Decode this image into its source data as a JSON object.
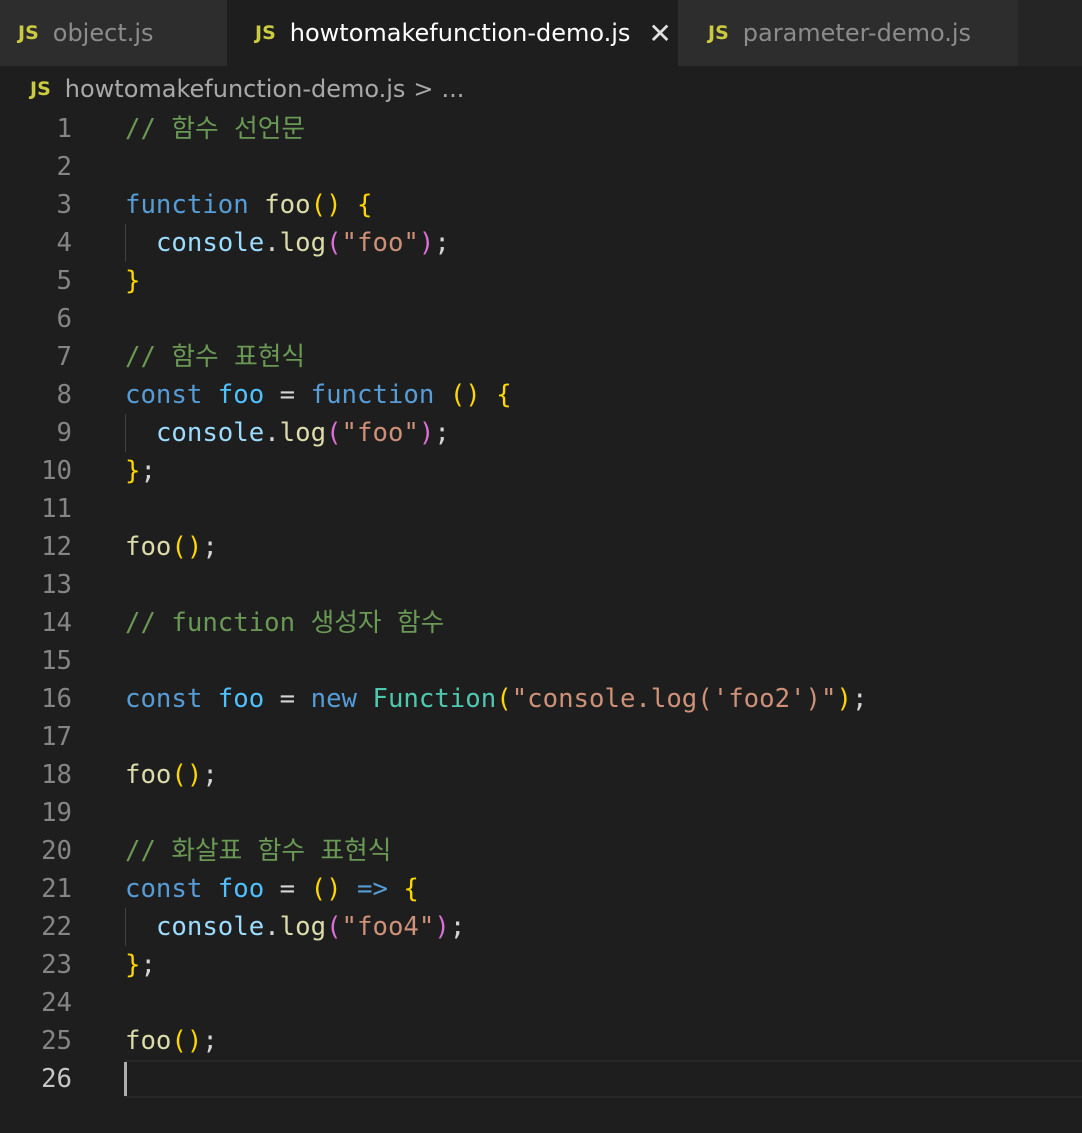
{
  "tabs": [
    {
      "icon": "JS",
      "label": "object.js",
      "active": false
    },
    {
      "icon": "JS",
      "label": "howtomakefunction-demo.js",
      "active": true
    },
    {
      "icon": "JS",
      "label": "parameter-demo.js",
      "active": false
    }
  ],
  "breadcrumb": {
    "icon": "JS",
    "file": "howtomakefunction-demo.js",
    "separator": ">",
    "more": "..."
  },
  "colors": {
    "keyword": "#569cd6",
    "function": "#dcdcaa",
    "string": "#ce9178",
    "comment": "#6a9955",
    "bracket1": "#ffd700",
    "bracket2": "#da70d6"
  },
  "current_line": 26,
  "lines": [
    [
      [
        "// 함수 선언문",
        "comment"
      ]
    ],
    [],
    [
      [
        "function",
        "kw"
      ],
      [
        " ",
        "p"
      ],
      [
        "foo",
        "fn"
      ],
      [
        "()",
        "b1"
      ],
      [
        " ",
        "p"
      ],
      [
        "{",
        "b1"
      ]
    ],
    [
      [
        "  ",
        "p"
      ],
      [
        "console",
        "var"
      ],
      [
        ".",
        "p"
      ],
      [
        "log",
        "fn"
      ],
      [
        "(",
        "b2"
      ],
      [
        "\"foo\"",
        "str"
      ],
      [
        ")",
        "b2"
      ],
      [
        ";",
        "p"
      ]
    ],
    [
      [
        "}",
        "b1"
      ]
    ],
    [],
    [
      [
        "// 함수 표현식",
        "comment"
      ]
    ],
    [
      [
        "const",
        "kw"
      ],
      [
        " ",
        "p"
      ],
      [
        "foo",
        "const"
      ],
      [
        " = ",
        "p"
      ],
      [
        "function",
        "kw"
      ],
      [
        " ",
        "p"
      ],
      [
        "()",
        "b1"
      ],
      [
        " ",
        "p"
      ],
      [
        "{",
        "b1"
      ]
    ],
    [
      [
        "  ",
        "p"
      ],
      [
        "console",
        "var"
      ],
      [
        ".",
        "p"
      ],
      [
        "log",
        "fn"
      ],
      [
        "(",
        "b2"
      ],
      [
        "\"foo\"",
        "str"
      ],
      [
        ")",
        "b2"
      ],
      [
        ";",
        "p"
      ]
    ],
    [
      [
        "}",
        "b1"
      ],
      [
        ";",
        "p"
      ]
    ],
    [],
    [
      [
        "foo",
        "fn"
      ],
      [
        "()",
        "b1"
      ],
      [
        ";",
        "p"
      ]
    ],
    [],
    [
      [
        "// function 생성자 함수",
        "comment"
      ]
    ],
    [],
    [
      [
        "const",
        "kw"
      ],
      [
        " ",
        "p"
      ],
      [
        "foo",
        "const"
      ],
      [
        " = ",
        "p"
      ],
      [
        "new",
        "kw"
      ],
      [
        " ",
        "p"
      ],
      [
        "Function",
        "cls"
      ],
      [
        "(",
        "b1"
      ],
      [
        "\"console.log('foo2')\"",
        "str"
      ],
      [
        ")",
        "b1"
      ],
      [
        ";",
        "p"
      ]
    ],
    [],
    [
      [
        "foo",
        "fn"
      ],
      [
        "()",
        "b1"
      ],
      [
        ";",
        "p"
      ]
    ],
    [],
    [
      [
        "// 화살표 함수 표현식",
        "comment"
      ]
    ],
    [
      [
        "const",
        "kw"
      ],
      [
        " ",
        "p"
      ],
      [
        "foo",
        "const"
      ],
      [
        " = ",
        "p"
      ],
      [
        "()",
        "b1"
      ],
      [
        " ",
        "p"
      ],
      [
        "=>",
        "kw"
      ],
      [
        " ",
        "p"
      ],
      [
        "{",
        "b1"
      ]
    ],
    [
      [
        "  ",
        "p"
      ],
      [
        "console",
        "var"
      ],
      [
        ".",
        "p"
      ],
      [
        "log",
        "fn"
      ],
      [
        "(",
        "b2"
      ],
      [
        "\"foo4\"",
        "str"
      ],
      [
        ")",
        "b2"
      ],
      [
        ";",
        "p"
      ]
    ],
    [
      [
        "}",
        "b1"
      ],
      [
        ";",
        "p"
      ]
    ],
    [],
    [
      [
        "foo",
        "fn"
      ],
      [
        "()",
        "b1"
      ],
      [
        ";",
        "p"
      ]
    ],
    []
  ]
}
